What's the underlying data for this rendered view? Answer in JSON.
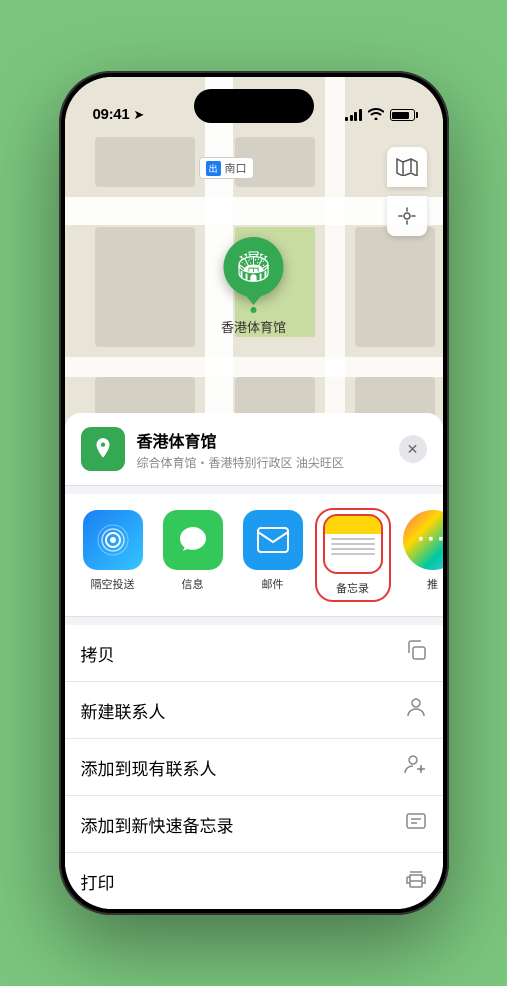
{
  "statusBar": {
    "time": "09:41",
    "timeIcon": "location-arrow"
  },
  "mapLabels": {
    "entrance": "南口",
    "entrancePrefix": "出"
  },
  "locationPin": {
    "label": "香港体育馆",
    "emoji": "🏟"
  },
  "locationCard": {
    "name": "香港体育馆",
    "subtitle": "综合体育馆・香港特别行政区 油尖旺区",
    "closeLabel": "✕"
  },
  "apps": [
    {
      "id": "airdrop",
      "label": "隔空投送",
      "emoji": "📡"
    },
    {
      "id": "messages",
      "label": "信息",
      "emoji": "💬"
    },
    {
      "id": "mail",
      "label": "邮件",
      "emoji": "✉️"
    },
    {
      "id": "notes",
      "label": "备忘录",
      "selected": true
    },
    {
      "id": "more",
      "label": "推",
      "emoji": "···"
    }
  ],
  "actions": [
    {
      "label": "拷贝",
      "icon": "⎘"
    },
    {
      "label": "新建联系人",
      "icon": "👤"
    },
    {
      "label": "添加到现有联系人",
      "icon": "👥"
    },
    {
      "label": "添加到新快速备忘录",
      "icon": "📋"
    },
    {
      "label": "打印",
      "icon": "🖨"
    }
  ]
}
